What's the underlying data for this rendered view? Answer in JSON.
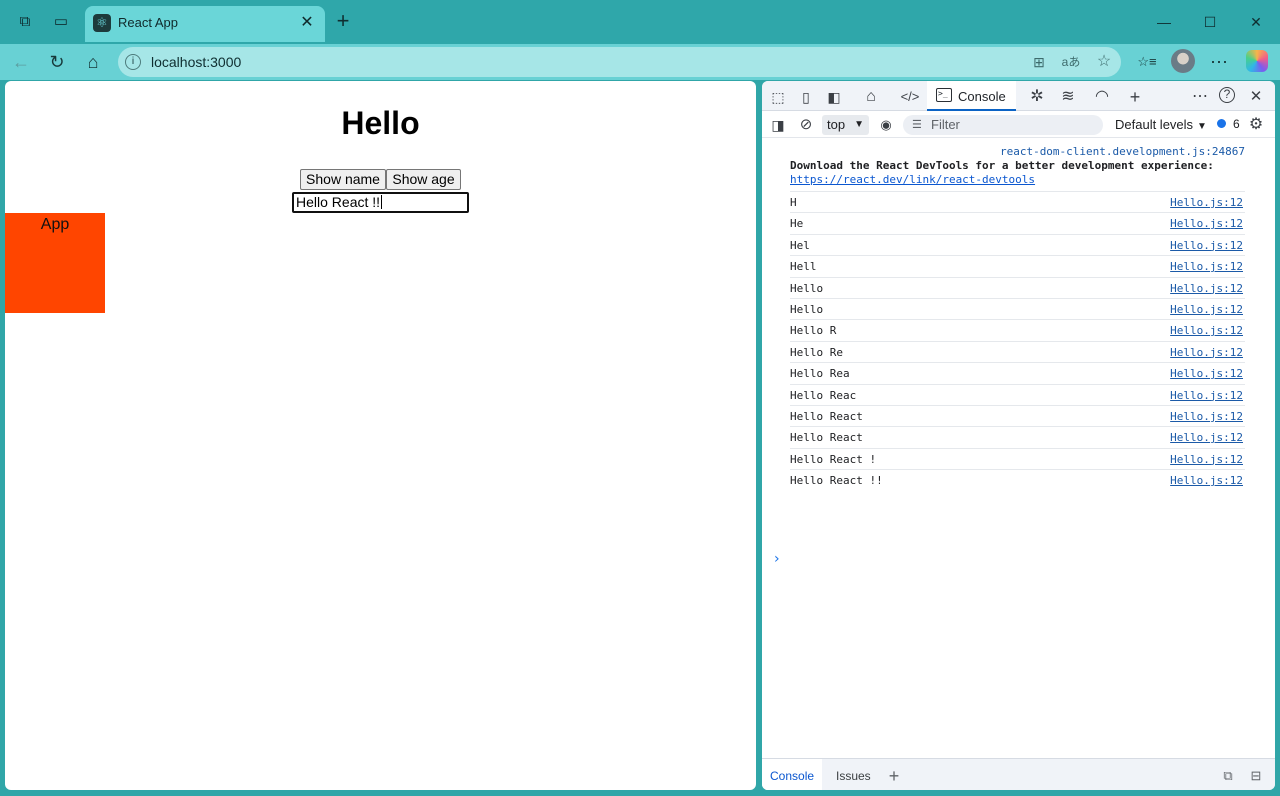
{
  "browser": {
    "tab_title": "React App",
    "url": "localhost:3000",
    "icons": {
      "workspaces": "workspaces-icon",
      "tab_actions": "tab-actions-icon",
      "react_favicon": "react-favicon-icon",
      "close": "close-icon",
      "new_tab": "plus-icon",
      "minimize": "minimize-icon",
      "maximize": "maximize-icon",
      "window_close": "window-close-icon",
      "back": "back-arrow-icon",
      "refresh": "refresh-icon",
      "home": "home-icon",
      "site_info": "info-icon",
      "split_screen": "split-screen-icon",
      "read_aloud": "read-aloud-icon",
      "favorite": "star-icon",
      "favorites": "favorites-icon",
      "more": "more-icon",
      "copilot": "copilot-icon"
    },
    "glyphs": {
      "close": "✕",
      "new_tab": "+",
      "minimize": "—",
      "maximize": "☐",
      "window_close": "✕",
      "back": "←",
      "refresh": "↻",
      "home": "⌂",
      "site_info": "i",
      "split_screen": "⊞",
      "read_aloud": "aあ",
      "favorite": "☆",
      "favorites": "☆≡",
      "more": "⋯",
      "workspaces": "⧉",
      "tab_actions": "▭",
      "react_favicon": "⚛"
    }
  },
  "page": {
    "heading": "Hello",
    "show_name_button": "Show name",
    "show_age_button": "Show age",
    "input_value": "Hello React !!",
    "app_box_label": "App",
    "app_box_color": "#ff4500"
  },
  "devtools": {
    "tabs": {
      "console": "Console"
    },
    "toolbar_glyphs": {
      "inspect": "⬚",
      "device": "▯",
      "dock": "◧",
      "welcome": "⌂",
      "elements": "</>",
      "console_icon": ">_",
      "sources": "✲",
      "network": "≋",
      "performance": "◠",
      "add": "+",
      "more": "⋯",
      "help": "?",
      "close": "✕"
    },
    "filterbar": {
      "sidebar_glyph": "◨",
      "clear_glyph": "⊘",
      "context": "top",
      "eye_glyph": "◉",
      "filter_placeholder": "Filter",
      "filter_glyph": "⏷",
      "levels": "Default levels",
      "issues_count": "6",
      "settings_glyph": "⚙"
    },
    "console": {
      "header_source": "react-dom-client.development.js:24867",
      "header_message": "Download the React DevTools for a better development experience:",
      "header_link": "https://react.dev/link/react-devtools",
      "rows": [
        {
          "text": "H",
          "source": "Hello.js:12"
        },
        {
          "text": "He",
          "source": "Hello.js:12"
        },
        {
          "text": "Hel",
          "source": "Hello.js:12"
        },
        {
          "text": "Hell",
          "source": "Hello.js:12"
        },
        {
          "text": "Hello",
          "source": "Hello.js:12"
        },
        {
          "text": "Hello",
          "source": "Hello.js:12"
        },
        {
          "text": "Hello R",
          "source": "Hello.js:12"
        },
        {
          "text": "Hello Re",
          "source": "Hello.js:12"
        },
        {
          "text": "Hello Rea",
          "source": "Hello.js:12"
        },
        {
          "text": "Hello Reac",
          "source": "Hello.js:12"
        },
        {
          "text": "Hello React",
          "source": "Hello.js:12"
        },
        {
          "text": "Hello React",
          "source": "Hello.js:12"
        },
        {
          "text": "Hello React !",
          "source": "Hello.js:12"
        },
        {
          "text": "Hello React !!",
          "source": "Hello.js:12"
        }
      ],
      "prompt_glyph": "›"
    },
    "drawer": {
      "console_tab": "Console",
      "issues_tab": "Issues",
      "add_glyph": "+",
      "icon1": "⧉",
      "icon2": "⊟"
    }
  }
}
